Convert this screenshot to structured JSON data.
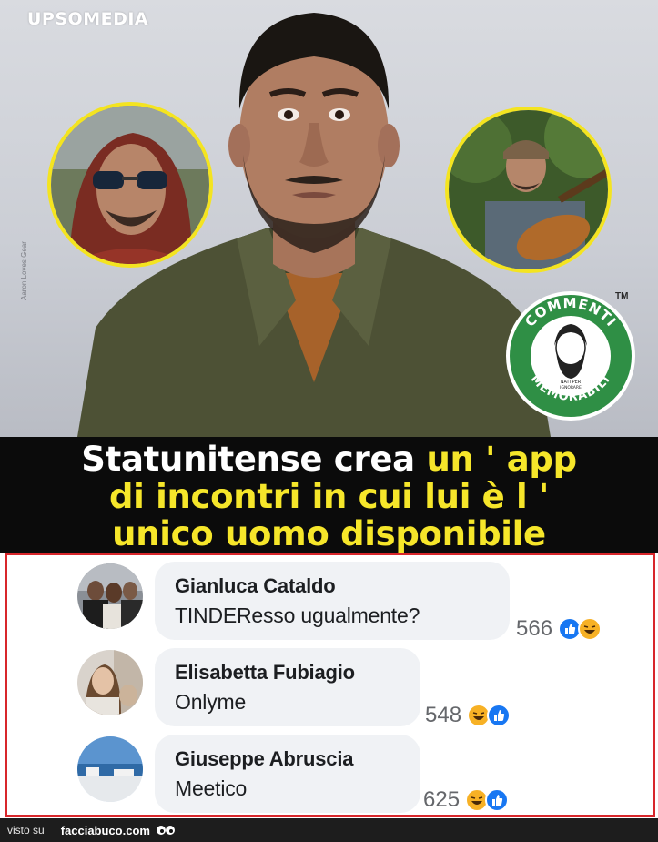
{
  "header": {
    "watermark": "UPSOMEDIA",
    "photo_credit": "Aaron Loves Gear"
  },
  "badge": {
    "top_text": "COMMENTI",
    "bottom_text": "MEMORABILI",
    "small_text_1": "NATI PER",
    "small_text_2": "IGNORARE",
    "tm": "TM"
  },
  "headline": {
    "line1_white": "Statunitense crea ",
    "line1_yellow": "un ' app",
    "line2": "di incontri in cui lui è l '",
    "line3": "unico uomo disponibile"
  },
  "comments": [
    {
      "author": "Gianluca Cataldo",
      "text": "TINDEResso ugualmente?",
      "count": "566",
      "reactions": [
        "like-icon",
        "haha-icon"
      ]
    },
    {
      "author": "Elisabetta Fubiagio",
      "text": "Onlyme",
      "count": "548",
      "reactions": [
        "haha-icon",
        "like-icon"
      ]
    },
    {
      "author": "Giuseppe Abruscia",
      "text": "Meetico",
      "count": "625",
      "reactions": [
        "haha-icon",
        "like-icon"
      ]
    }
  ],
  "footer": {
    "visto": "visto su",
    "site": "facciabuco.com"
  },
  "colors": {
    "headline_yellow": "#f6e62a",
    "frame_red": "#d8262b",
    "circle_yellow": "#f4e420",
    "badge_green": "#2f8f45",
    "like_blue": "#1877f2",
    "haha_yellow": "#f7b125"
  }
}
